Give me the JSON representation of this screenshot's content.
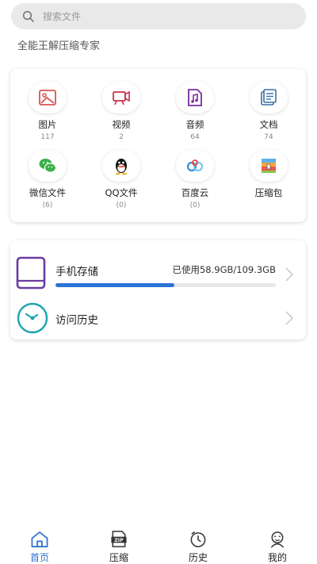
{
  "search": {
    "placeholder": "搜索文件"
  },
  "subtitle": "全能王解压缩专家",
  "categories": [
    {
      "label": "图片",
      "count": "117",
      "icon": "image-icon"
    },
    {
      "label": "视频",
      "count": "2",
      "icon": "video-icon"
    },
    {
      "label": "音频",
      "count": "64",
      "icon": "music-icon"
    },
    {
      "label": "文档",
      "count": "74",
      "icon": "document-icon"
    },
    {
      "label": "微信文件",
      "count": "(6)",
      "icon": "wechat-icon"
    },
    {
      "label": "QQ文件",
      "count": "(0)",
      "icon": "qq-icon"
    },
    {
      "label": "百度云",
      "count": "(0)",
      "icon": "baidu-cloud-icon"
    },
    {
      "label": "压缩包",
      "count": "",
      "icon": "archive-icon"
    }
  ],
  "storage": {
    "title": "手机存储",
    "usage": "已使用58.9GB/109.3GB",
    "used_fraction": 0.539
  },
  "history": {
    "title": "访问历史"
  },
  "tabs": [
    {
      "label": "首页",
      "active": true,
      "icon": "home-icon"
    },
    {
      "label": "压缩",
      "active": false,
      "icon": "zip-icon"
    },
    {
      "label": "历史",
      "active": false,
      "icon": "clock-icon"
    },
    {
      "label": "我的",
      "active": false,
      "icon": "profile-icon"
    }
  ],
  "colors": {
    "accent": "#2b6fcf",
    "progress": "#2b73d6",
    "phone": "#6a3ba0",
    "history": "#1ba3b0"
  }
}
